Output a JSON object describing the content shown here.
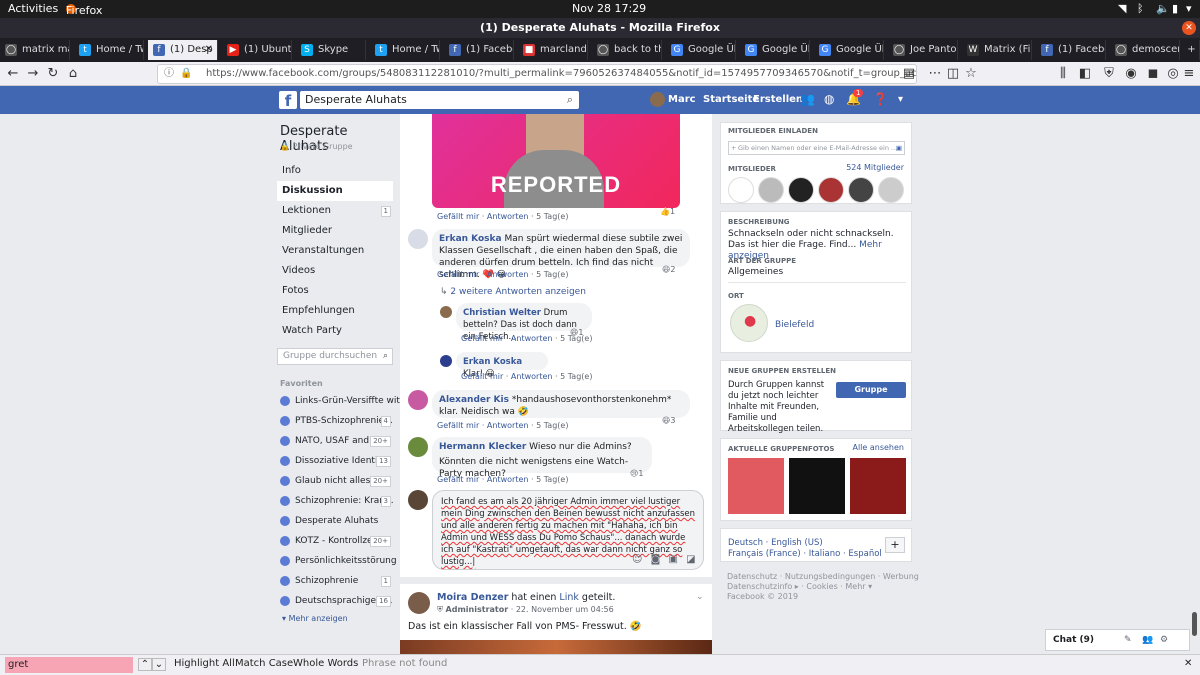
{
  "system": {
    "activities": "Activities",
    "app": "Firefox Web Browser",
    "clock": "Nov 28  17:29"
  },
  "window": {
    "title": "(1) Desperate Aluhats - Mozilla Firefox"
  },
  "tabs": [
    {
      "label": "matrix mai",
      "color": "#555",
      "glyph": "◯"
    },
    {
      "label": "Home / Twit",
      "color": "#1da1f2",
      "glyph": "t"
    },
    {
      "label": "(1) Desp",
      "color": "#4267b2",
      "glyph": "f"
    },
    {
      "label": "(1) Ubuntu",
      "color": "#e62117",
      "glyph": "▶"
    },
    {
      "label": "Skype",
      "color": "#00aff0",
      "glyph": "S"
    },
    {
      "label": "Home / Twit",
      "color": "#1da1f2",
      "glyph": "t"
    },
    {
      "label": "(1) Faceboo",
      "color": "#4267b2",
      "glyph": "f"
    },
    {
      "label": "marclando",
      "color": "#d33",
      "glyph": "■"
    },
    {
      "label": "back to the",
      "color": "#555",
      "glyph": "◯"
    },
    {
      "label": "Google Übe",
      "color": "#4285f4",
      "glyph": "G"
    },
    {
      "label": "Google Übe",
      "color": "#4285f4",
      "glyph": "G"
    },
    {
      "label": "Google Übe",
      "color": "#4285f4",
      "glyph": "G"
    },
    {
      "label": "Joe Pantoli",
      "color": "#555",
      "glyph": "◯"
    },
    {
      "label": "Matrix (Filr",
      "color": "#333",
      "glyph": "W"
    },
    {
      "label": "(1) Faceboo",
      "color": "#4267b2",
      "glyph": "f"
    },
    {
      "label": "demoscene",
      "color": "#555",
      "glyph": "◯"
    }
  ],
  "url": "https://www.facebook.com/groups/548083112281010/?multi_permalink=796052637484055&notif_id=1574957709346570&notif_t=group_activity",
  "fb": {
    "search": "Desperate Aluhats",
    "user": "Marc",
    "home": "Startseite",
    "create": "Erstellen",
    "notif_count": "1"
  },
  "group": {
    "name": "Desperate Aluhats",
    "privacy": "Private Gruppe"
  },
  "nav": [
    {
      "label": "Info",
      "badge": ""
    },
    {
      "label": "Diskussion",
      "badge": ""
    },
    {
      "label": "Lektionen",
      "badge": "1"
    },
    {
      "label": "Mitglieder",
      "badge": ""
    },
    {
      "label": "Veranstaltungen",
      "badge": ""
    },
    {
      "label": "Videos",
      "badge": ""
    },
    {
      "label": "Fotos",
      "badge": ""
    },
    {
      "label": "Empfehlungen",
      "badge": ""
    },
    {
      "label": "Watch Party",
      "badge": ""
    }
  ],
  "group_search_placeholder": "Gruppe durchsuchen",
  "favorites_title": "Favoriten",
  "favorites": [
    {
      "label": "Links-Grün-Versiffte wit...",
      "badge": ""
    },
    {
      "label": "PTBS-Schizophrenie...",
      "badge": "4"
    },
    {
      "label": "NATO, USAF and CIA",
      "badge": "20+"
    },
    {
      "label": "Dissoziative Identit...",
      "badge": "13"
    },
    {
      "label": "Glaub nicht alles!",
      "badge": "20+"
    },
    {
      "label": "Schizophrenie: Kran...",
      "badge": "3"
    },
    {
      "label": "Desperate Aluhats",
      "badge": ""
    },
    {
      "label": "KOTZ - Kontrollzen...",
      "badge": "20+"
    },
    {
      "label": "Persönlichkeitsstörung ...",
      "badge": ""
    },
    {
      "label": "Schizophrenie",
      "badge": "1"
    },
    {
      "label": "Deutschsprachige L...",
      "badge": "16"
    }
  ],
  "more": "Mehr anzeigen",
  "feed": {
    "image_text": "REPORTED",
    "like": "Gefällt mir",
    "reply": "Antworten",
    "c0_time": "5 Tag(e)",
    "c0_rx": "1",
    "c1_name": "Erkan Koska",
    "c1_text": "Man spürt wiedermal diese subtile zwei Klassen Gesellschaft , die einen haben den Spaß, die anderen dürfen drum betteln. Ich find das nicht schlimm. ❤️ 😀",
    "c1_time": "5 Tag(e)",
    "c1_rx": "2",
    "more_replies": "2 weitere Antworten anzeigen",
    "r1_name": "Christian Welter",
    "r1_text": "Drum betteln? Das ist doch dann ein Fetisch...",
    "r1_time": "5 Tag(e)",
    "r1_rx": "1",
    "r2_name": "Erkan Koska",
    "r2_text": "Klar! 😀",
    "r2_time": "5 Tag(e)",
    "c2_name": "Alexander Kis",
    "c2_text": "*handaushosevonthorstenkonehm* klar. Neidisch wa 🤣",
    "c2_time": "5 Tag(e)",
    "c2_rx": "3",
    "c3_name": "Hermann Klecker",
    "c3_text1": "Wieso nur die Admins?",
    "c3_text2": "Könnten die nicht wenigstens eine Watch-Party machen?",
    "c3_time": "5 Tag(e)",
    "c3_rx": "1",
    "draft": "Ich fand es am als 20 jähriger Admin immer viel lustiger mein Ding zwinschen den Beinen bewusst nicht anzufassen und alle anderen fertig zu machen mit \"Hahaha, ich bin Admin und WESS dass Du Pomo Schaus\"... danach wurde ich auf \"Kastrati\" umgetauft, das war dann nicht ganz so lustig...",
    "post_author": "Moira Denzer",
    "post_action": "hat einen",
    "post_link": "Link",
    "post_action2": "geteilt.",
    "post_role": "Administrator",
    "post_date": "22. November um 04:56",
    "post_text": "Das ist ein klassischer Fall von PMS- Fresswut. 🤣"
  },
  "right": {
    "invite_title": "Mitglieder einladen",
    "invite_placeholder": "Gib einen Namen oder eine E-Mail-Adresse ein ...",
    "members_title": "Mitglieder",
    "members_count": "524 Mitglieder",
    "desc_title": "Beschreibung",
    "desc_text": "Schnackseln oder nicht schnackseln. Das ist hier die Frage. Find...",
    "desc_more": "Mehr anzeigen",
    "type_title": "Art der Gruppe",
    "type_text": "Allgemeines",
    "loc_title": "Ort",
    "loc_text": "Bielefeld",
    "new_title": "Neue Gruppen erstellen",
    "new_text": "Durch Gruppen kannst du jetzt noch leichter Inhalte mit Freunden, Familie und Arbeitskollegen teilen.",
    "new_btn": "Gruppe erstellen",
    "photos_title": "Aktuelle Gruppenfotos",
    "photos_all": "Alle ansehen",
    "lang_current": "Deutsch · English (US)",
    "lang_more": "Français (France) · Italiano · Español",
    "footer1": "Datenschutz · Nutzungsbedingungen · Werbung",
    "footer2": "Datenschutzinfo ▸ · Cookies · Mehr ▾",
    "footer3": "Facebook © 2019",
    "chat": "Chat (9)"
  },
  "findbar": {
    "query": "gret",
    "highlight": "Highlight All",
    "match_case": "Match Case",
    "whole_words": "Whole Words",
    "status": "Phrase not found"
  }
}
